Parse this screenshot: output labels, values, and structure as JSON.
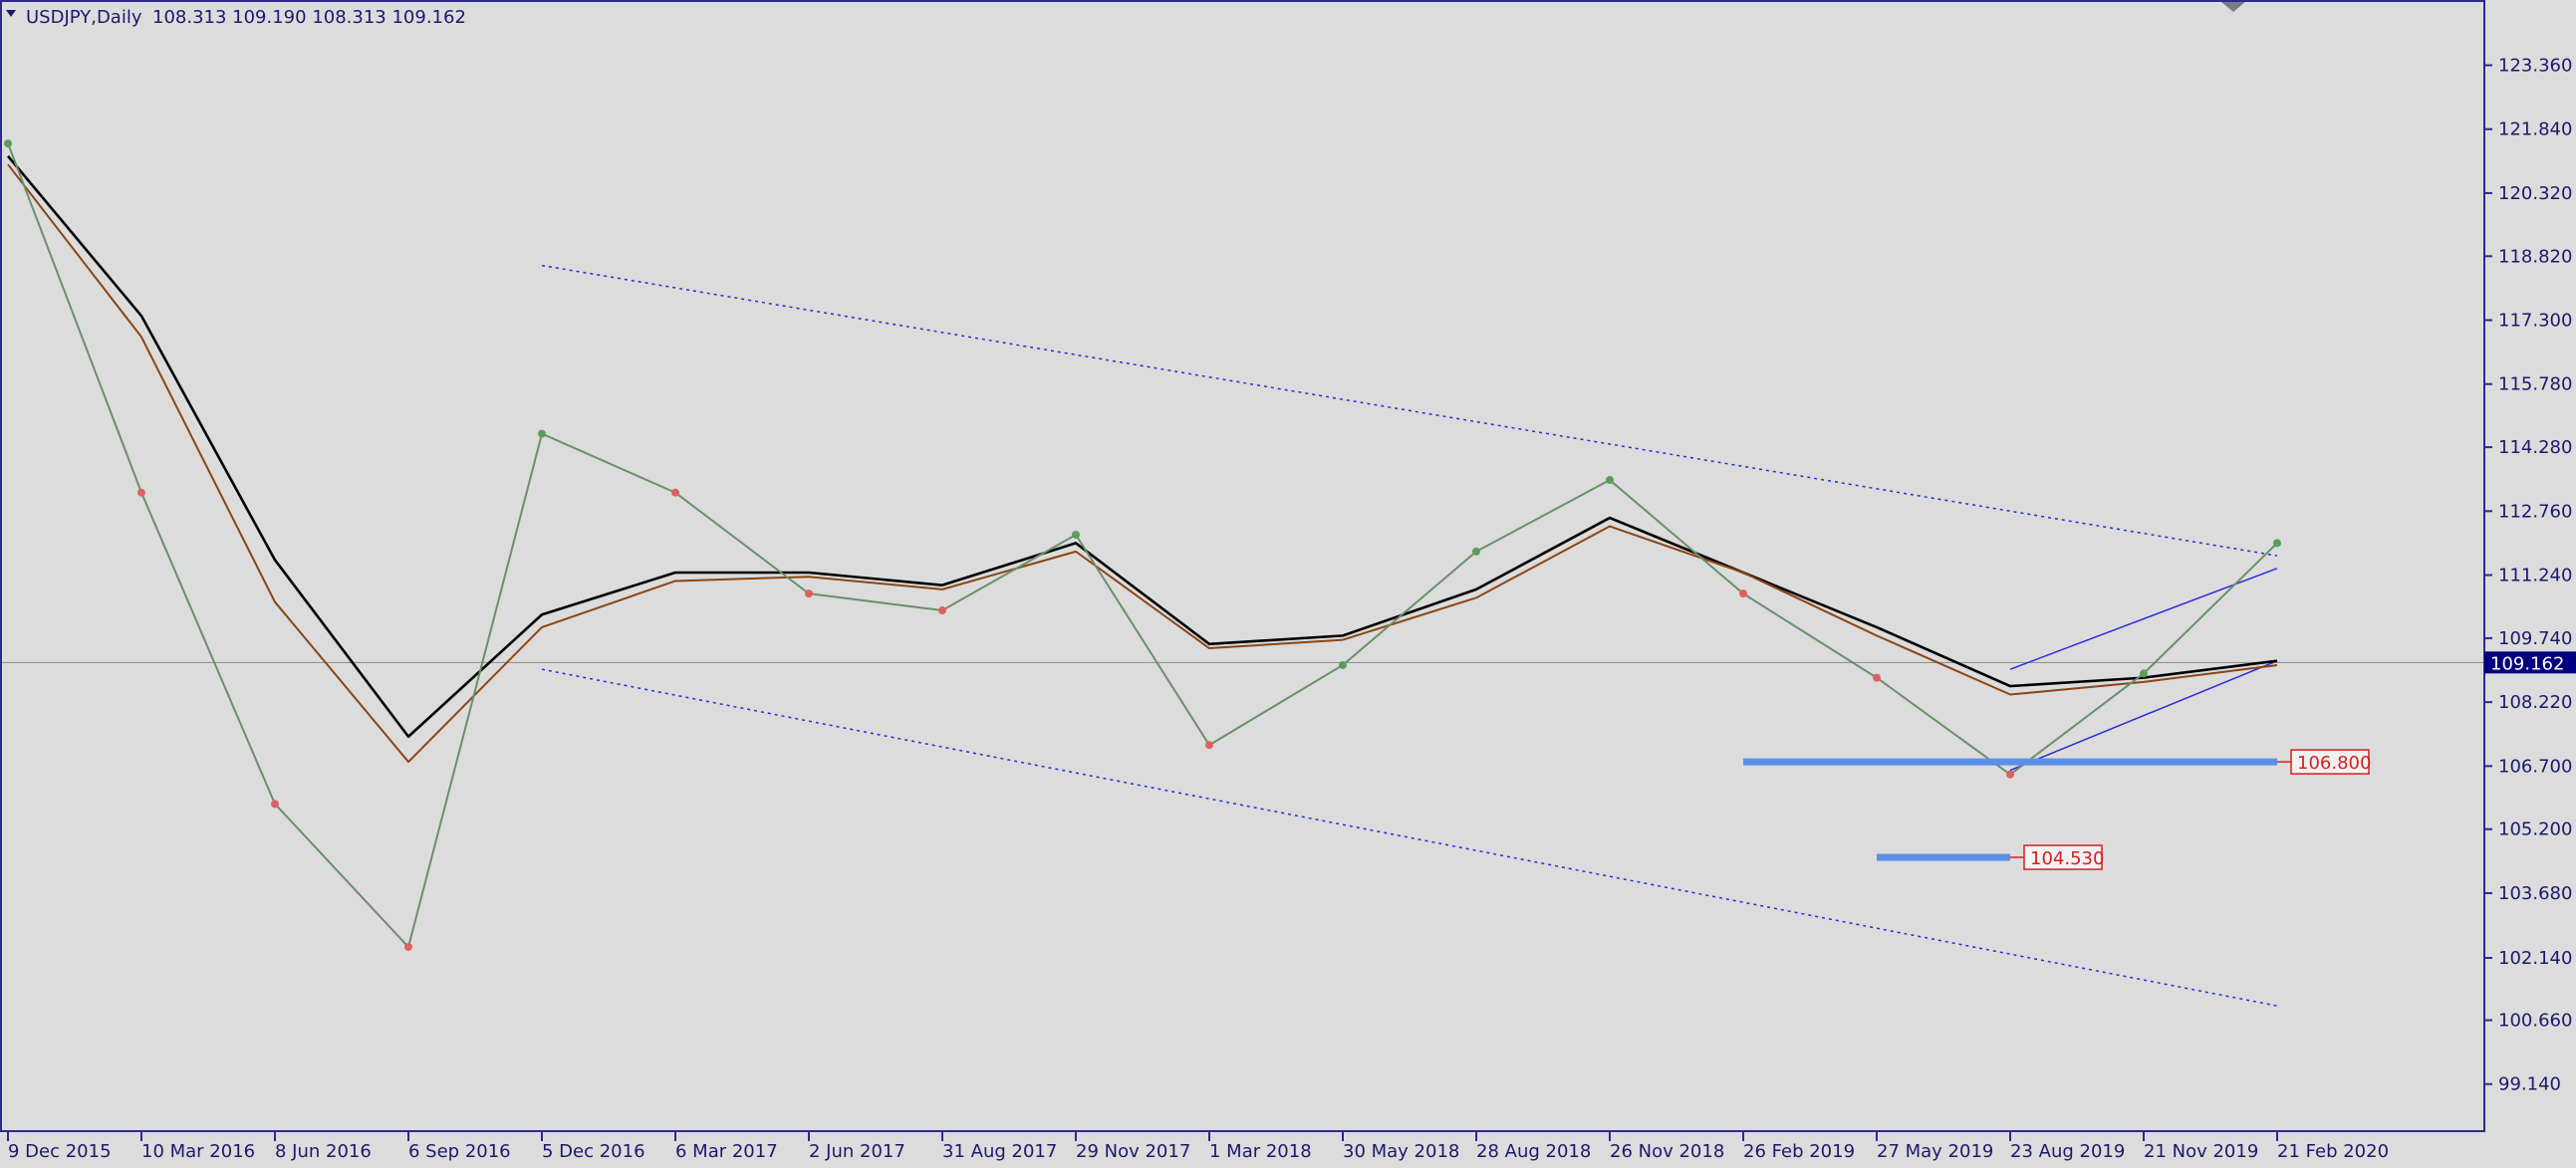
{
  "window": {
    "symbol": "USDJPY,Daily",
    "ohlc": "108.313 109.190 108.313 109.162",
    "menu_icon": "triangle-down-icon",
    "scroll_marker_icon": "triangle-down-icon"
  },
  "colors": {
    "background": "#dcdcdc",
    "frame": "#2b2b8f",
    "bull_candle": "#5a9e5a",
    "bear_candle": "#e06060",
    "ma_fast": "#000000",
    "ma_slow": "#8b4513",
    "trend_line": "#2b2bd6",
    "support_line": "#5b8fe8",
    "label_red": "#d42020",
    "current_price_bg": "#000080"
  },
  "chart_data": {
    "type": "line",
    "title": "USDJPY,Daily",
    "ylim": [
      98.4,
      124.2
    ],
    "x_tick_labels": [
      "9 Dec 2015",
      "10 Mar 2016",
      "8 Jun 2016",
      "6 Sep 2016",
      "5 Dec 2016",
      "6 Mar 2017",
      "2 Jun 2017",
      "31 Aug 2017",
      "29 Nov 2017",
      "1 Mar 2018",
      "30 May 2018",
      "28 Aug 2018",
      "26 Nov 2018",
      "26 Feb 2019",
      "27 May 2019",
      "23 Aug 2019",
      "21 Nov 2019",
      "21 Feb 2020"
    ],
    "y_tick_labels": [
      "123.360",
      "121.840",
      "120.320",
      "118.820",
      "117.300",
      "115.780",
      "114.280",
      "112.760",
      "111.240",
      "109.740",
      "108.220",
      "106.700",
      "105.200",
      "103.680",
      "102.140",
      "100.660",
      "99.140"
    ],
    "series": [
      {
        "style": "price",
        "x": [
          "9 Dec 2015",
          "10 Mar 2016",
          "8 Jun 2016",
          "6 Sep 2016",
          "5 Dec 2016",
          "6 Mar 2017",
          "2 Jun 2017",
          "31 Aug 2017",
          "29 Nov 2017",
          "1 Mar 2018",
          "30 May 2018",
          "28 Aug 2018",
          "26 Nov 2018",
          "26 Feb 2019",
          "27 May 2019",
          "23 Aug 2019",
          "21 Nov 2019",
          "21 Feb 2020"
        ],
        "values": [
          121.5,
          113.2,
          105.8,
          102.4,
          114.6,
          113.2,
          110.8,
          110.4,
          112.2,
          107.2,
          109.1,
          111.8,
          113.5,
          110.8,
          108.8,
          106.5,
          108.9,
          112.0
        ]
      },
      {
        "style": "ma_fast",
        "x": [
          "9 Dec 2015",
          "10 Mar 2016",
          "8 Jun 2016",
          "6 Sep 2016",
          "5 Dec 2016",
          "6 Mar 2017",
          "2 Jun 2017",
          "31 Aug 2017",
          "29 Nov 2017",
          "1 Mar 2018",
          "30 May 2018",
          "28 Aug 2018",
          "26 Nov 2018",
          "26 Feb 2019",
          "27 May 2019",
          "23 Aug 2019",
          "21 Nov 2019",
          "21 Feb 2020"
        ],
        "values": [
          121.2,
          117.4,
          111.6,
          107.4,
          110.3,
          111.3,
          111.3,
          111.0,
          112.0,
          109.6,
          109.8,
          110.9,
          112.6,
          111.3,
          110.0,
          108.6,
          108.8,
          109.2
        ]
      },
      {
        "style": "ma_slow",
        "x": [
          "9 Dec 2015",
          "10 Mar 2016",
          "8 Jun 2016",
          "6 Sep 2016",
          "5 Dec 2016",
          "6 Mar 2017",
          "2 Jun 2017",
          "31 Aug 2017",
          "29 Nov 2017",
          "1 Mar 2018",
          "30 May 2018",
          "28 Aug 2018",
          "26 Nov 2018",
          "26 Feb 2019",
          "27 May 2019",
          "23 Aug 2019",
          "21 Nov 2019",
          "21 Feb 2020"
        ],
        "values": [
          121.0,
          116.9,
          110.6,
          106.8,
          110.0,
          111.1,
          111.2,
          110.9,
          111.8,
          109.5,
          109.7,
          110.7,
          112.4,
          111.3,
          109.8,
          108.4,
          108.7,
          109.1
        ]
      }
    ],
    "trend_lines": [
      {
        "x1": "5 Dec 2016",
        "y1": 118.6,
        "x2": "21 Feb 2020",
        "y2": 111.7
      },
      {
        "x1": "5 Dec 2016",
        "y1": 109.0,
        "x2": "21 Feb 2020",
        "y2": 101.0
      },
      {
        "x1": "23 Aug 2019",
        "y1": 109.0,
        "x2": "21 Feb 2020",
        "y2": 111.4
      },
      {
        "x1": "23 Aug 2019",
        "y1": 106.6,
        "x2": "21 Feb 2020",
        "y2": 109.2
      }
    ],
    "horizontal_levels": [
      {
        "value": 106.8,
        "label": "106.800",
        "from": "26 Feb 2019",
        "to": "21 Feb 2020"
      },
      {
        "value": 104.53,
        "label": "104.530",
        "from": "27 May 2019",
        "to": "23 Aug 2019"
      }
    ],
    "current_price": 109.162,
    "current_price_label": "109.162"
  }
}
